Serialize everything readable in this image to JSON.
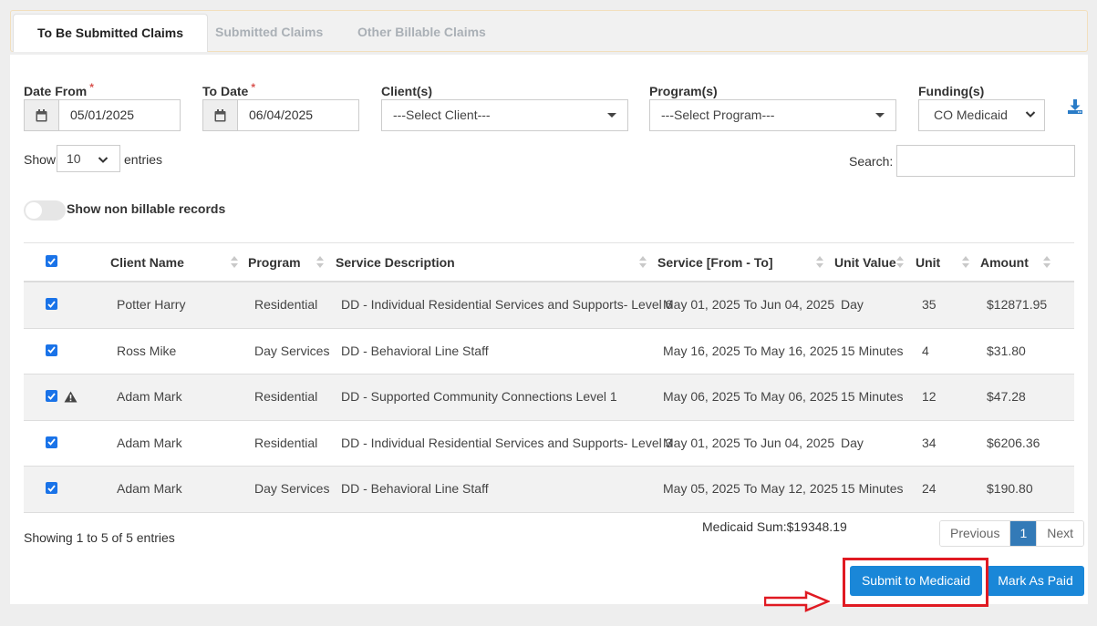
{
  "tabs": [
    {
      "label": "To Be Submitted Claims",
      "active": true
    },
    {
      "label": "Submitted Claims",
      "active": false
    },
    {
      "label": "Other Billable Claims",
      "active": false
    }
  ],
  "filters": {
    "date_from_label": "Date From",
    "date_from_value": "05/01/2025",
    "to_date_label": "To Date",
    "to_date_value": "06/04/2025",
    "required_mark": "*",
    "clients_label": "Client(s)",
    "clients_value": "---Select Client---",
    "programs_label": "Program(s)",
    "programs_value": "---Select Program---",
    "fundings_label": "Funding(s)",
    "fundings_value": "CO Medicaid"
  },
  "length": {
    "show": "Show",
    "value": "10",
    "entries": "entries"
  },
  "search": {
    "label": "Search:",
    "value": ""
  },
  "toggle": {
    "label": "Show non billable records",
    "on": false
  },
  "table": {
    "columns": [
      "Client Name",
      "Program",
      "Service Description",
      "Service [From - To]",
      "Unit Value",
      "Unit",
      "Amount"
    ],
    "rows": [
      {
        "client": "Potter Harry",
        "program": "Residential",
        "service": "DD - Individual Residential Services and Supports- Level 6",
        "period": "May 01, 2025 To Jun 04, 2025",
        "unit_value": "Day",
        "unit": "35",
        "amount": "$12871.95",
        "warning": false
      },
      {
        "client": "Ross Mike",
        "program": "Day Services",
        "service": "DD - Behavioral Line Staff",
        "period": "May 16, 2025 To May 16, 2025",
        "unit_value": "15 Minutes",
        "unit": "4",
        "amount": "$31.80",
        "warning": false
      },
      {
        "client": "Adam Mark",
        "program": "Residential",
        "service": "DD - Supported Community Connections Level 1",
        "period": "May 06, 2025 To May 06, 2025",
        "unit_value": "15 Minutes",
        "unit": "12",
        "amount": "$47.28",
        "warning": true
      },
      {
        "client": "Adam Mark",
        "program": "Residential",
        "service": "DD - Individual Residential Services and Supports- Level 3",
        "period": "May 01, 2025 To Jun 04, 2025",
        "unit_value": "Day",
        "unit": "34",
        "amount": "$6206.36",
        "warning": false
      },
      {
        "client": "Adam Mark",
        "program": "Day Services",
        "service": "DD - Behavioral Line Staff",
        "period": "May 05, 2025 To May 12, 2025",
        "unit_value": "15 Minutes",
        "unit": "24",
        "amount": "$190.80",
        "warning": false
      }
    ]
  },
  "info": "Showing 1 to 5 of 5 entries",
  "pagination": {
    "previous": "Previous",
    "current": "1",
    "next": "Next"
  },
  "footer": {
    "medicaid_sum": "Medicaid Sum:$19348.19",
    "submit_label": "Submit to Medicaid",
    "mark_paid_label": "Mark As Paid"
  },
  "colors": {
    "accent": "#1a87d8",
    "checkbox": "#1a73e8",
    "annotation": "#e01a22"
  }
}
